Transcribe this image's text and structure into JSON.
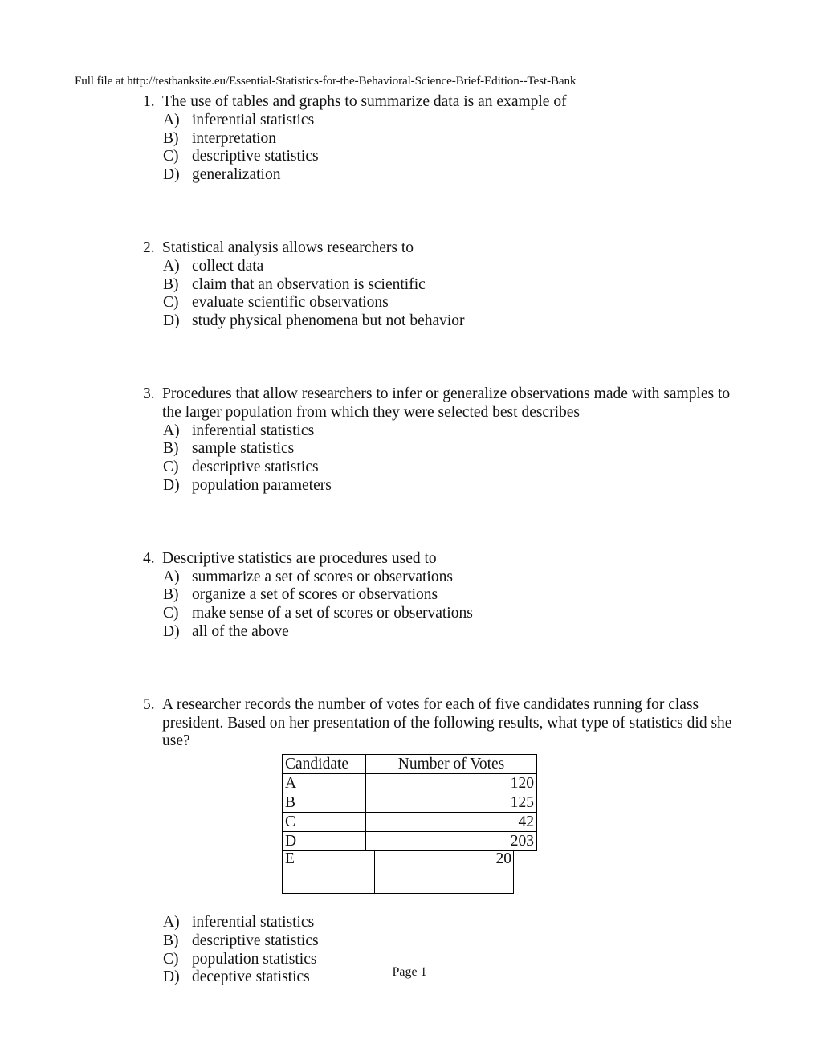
{
  "header": {
    "text": "Full file at http://testbanksite.eu/Essential-Statistics-for-the-Behavioral-Science-Brief-Edition--Test-Bank"
  },
  "questions": [
    {
      "number": "1.",
      "text": "The use of tables and graphs to summarize data is an example of",
      "options": [
        {
          "letter": "A)",
          "text": "inferential statistics"
        },
        {
          "letter": "B)",
          "text": "interpretation"
        },
        {
          "letter": "C)",
          "text": "descriptive statistics"
        },
        {
          "letter": "D)",
          "text": "generalization"
        }
      ]
    },
    {
      "number": "2.",
      "text": "Statistical analysis allows researchers to",
      "options": [
        {
          "letter": "A)",
          "text": "collect data"
        },
        {
          "letter": "B)",
          "text": "claim that an observation is scientific"
        },
        {
          "letter": "C)",
          "text": "evaluate scientific observations"
        },
        {
          "letter": "D)",
          "text": "study physical phenomena but not behavior"
        }
      ]
    },
    {
      "number": "3.",
      "text": "Procedures that allow researchers to infer or generalize observations made with samples to the larger population from which they were selected best describes",
      "options": [
        {
          "letter": "A)",
          "text": "inferential statistics"
        },
        {
          "letter": "B)",
          "text": "sample statistics"
        },
        {
          "letter": "C)",
          "text": "descriptive statistics"
        },
        {
          "letter": "D)",
          "text": "population parameters"
        }
      ]
    },
    {
      "number": "4.",
      "text": "Descriptive statistics are procedures used to",
      "options": [
        {
          "letter": "A)",
          "text": "summarize a set of scores or observations"
        },
        {
          "letter": "B)",
          "text": "organize a set of scores or observations"
        },
        {
          "letter": "C)",
          "text": "make sense of a set of scores or observations"
        },
        {
          "letter": "D)",
          "text": "all of the above"
        }
      ]
    },
    {
      "number": "5.",
      "text": "A researcher records the number of votes for each of five candidates running for class president. Based on her presentation of the following results, what type of statistics did she use?",
      "options": [
        {
          "letter": "A)",
          "text": "inferential statistics"
        },
        {
          "letter": "B)",
          "text": "descriptive statistics"
        },
        {
          "letter": "C)",
          "text": "population statistics"
        },
        {
          "letter": "D)",
          "text": "deceptive statistics"
        }
      ]
    }
  ],
  "vote_table": {
    "headers": [
      "Candidate",
      "Number of Votes"
    ],
    "rows": [
      {
        "candidate": "A",
        "votes": "120"
      },
      {
        "candidate": "B",
        "votes": "125"
      },
      {
        "candidate": "C",
        "votes": "42"
      },
      {
        "candidate": "D",
        "votes": "203"
      }
    ],
    "last_row": {
      "candidate": "E",
      "votes": "20"
    }
  },
  "footer": {
    "page_label": "Page 1"
  }
}
